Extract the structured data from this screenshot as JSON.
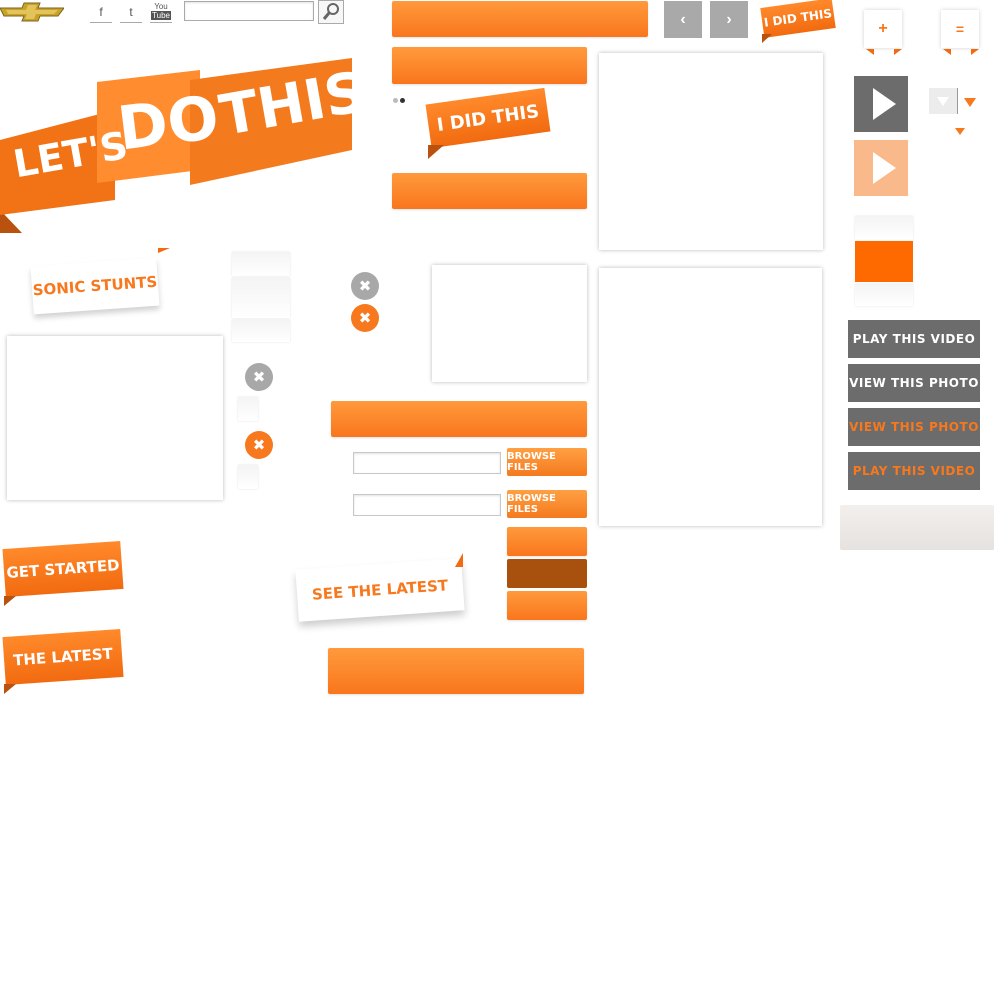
{
  "header": {
    "logo_icon": "chevrolet-bowtie-icon",
    "social": {
      "facebook": "f",
      "twitter": "t",
      "youtube_top": "You",
      "youtube_bottom": "Tube"
    },
    "search": {
      "placeholder": "",
      "icon": "magnifier-icon"
    }
  },
  "hero": {
    "word1": "LET'S",
    "word2": "DO",
    "word3": "THIS"
  },
  "ribbons": {
    "i_did_this_small": "I DID THIS",
    "i_did_this": "I DID THIS",
    "sonic_stunts": "SONIC STUNTS",
    "get_started": "GET STARTED",
    "the_latest": "THE LATEST",
    "see_the_latest": "SEE THE LATEST"
  },
  "nav": {
    "prev_icon": "chevron-left-icon",
    "next_icon": "chevron-right-icon"
  },
  "controls": {
    "plus": "+",
    "equals": "="
  },
  "buttons": {
    "play_video_1": "PLAY THIS VIDEO",
    "view_photo_1": "VIEW THIS PHOTO",
    "view_photo_2": "VIEW THIS PHOTO",
    "play_video_2": "PLAY THIS VIDEO",
    "browse_1": "BROWSE FILES",
    "browse_2": "BROWSE FILES"
  },
  "upload": {
    "field1_value": "",
    "field2_value": ""
  },
  "icons": {
    "close": "✖",
    "play": "play-icon",
    "dropdown": "triangle-down-icon"
  },
  "colors": {
    "accent": "#f7781d",
    "accent_dark": "#a8510f",
    "gray_button": "#6c6c6c",
    "orange_text": "#f7781d"
  }
}
